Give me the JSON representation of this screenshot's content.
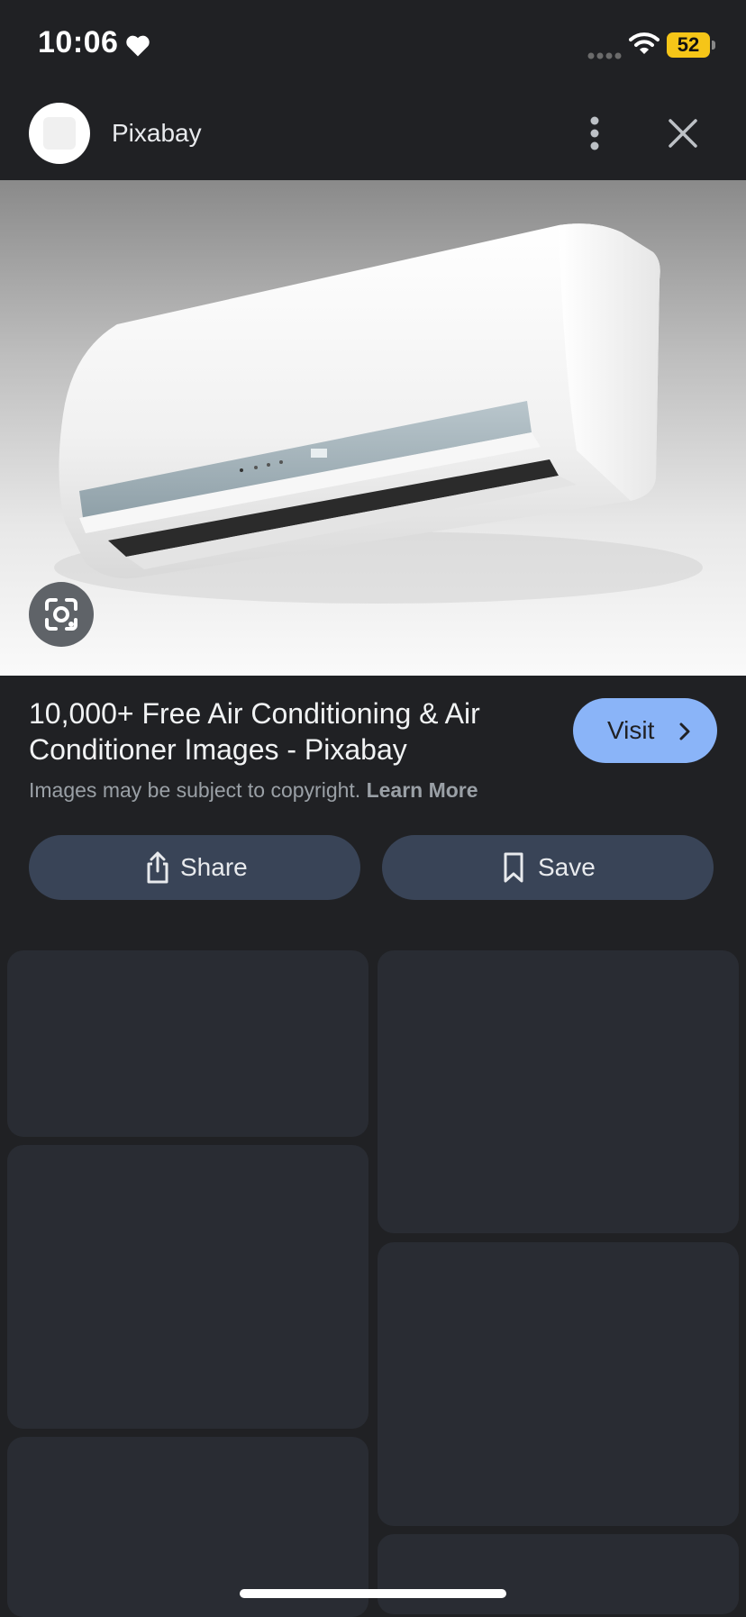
{
  "status_bar": {
    "time": "10:06",
    "battery": "52",
    "icons": [
      "heart-icon",
      "cellular-signal-icon",
      "wifi-icon",
      "battery-icon"
    ]
  },
  "header": {
    "site_name": "Pixabay",
    "icons": [
      "more-vert-icon",
      "close-icon"
    ]
  },
  "result": {
    "title": "10,000+ Free Air Conditioning & Air Conditioner Images - Pixabay",
    "copyright_text": "Images may be subject to copyright.",
    "learn_more": "Learn More",
    "visit_label": "Visit"
  },
  "actions": {
    "share_label": "Share",
    "save_label": "Save"
  },
  "colors": {
    "background": "#202124",
    "visit_button": "#8ab4f8",
    "action_button": "#394457",
    "placeholder_tile": "#292c33",
    "battery": "#f5c518"
  }
}
